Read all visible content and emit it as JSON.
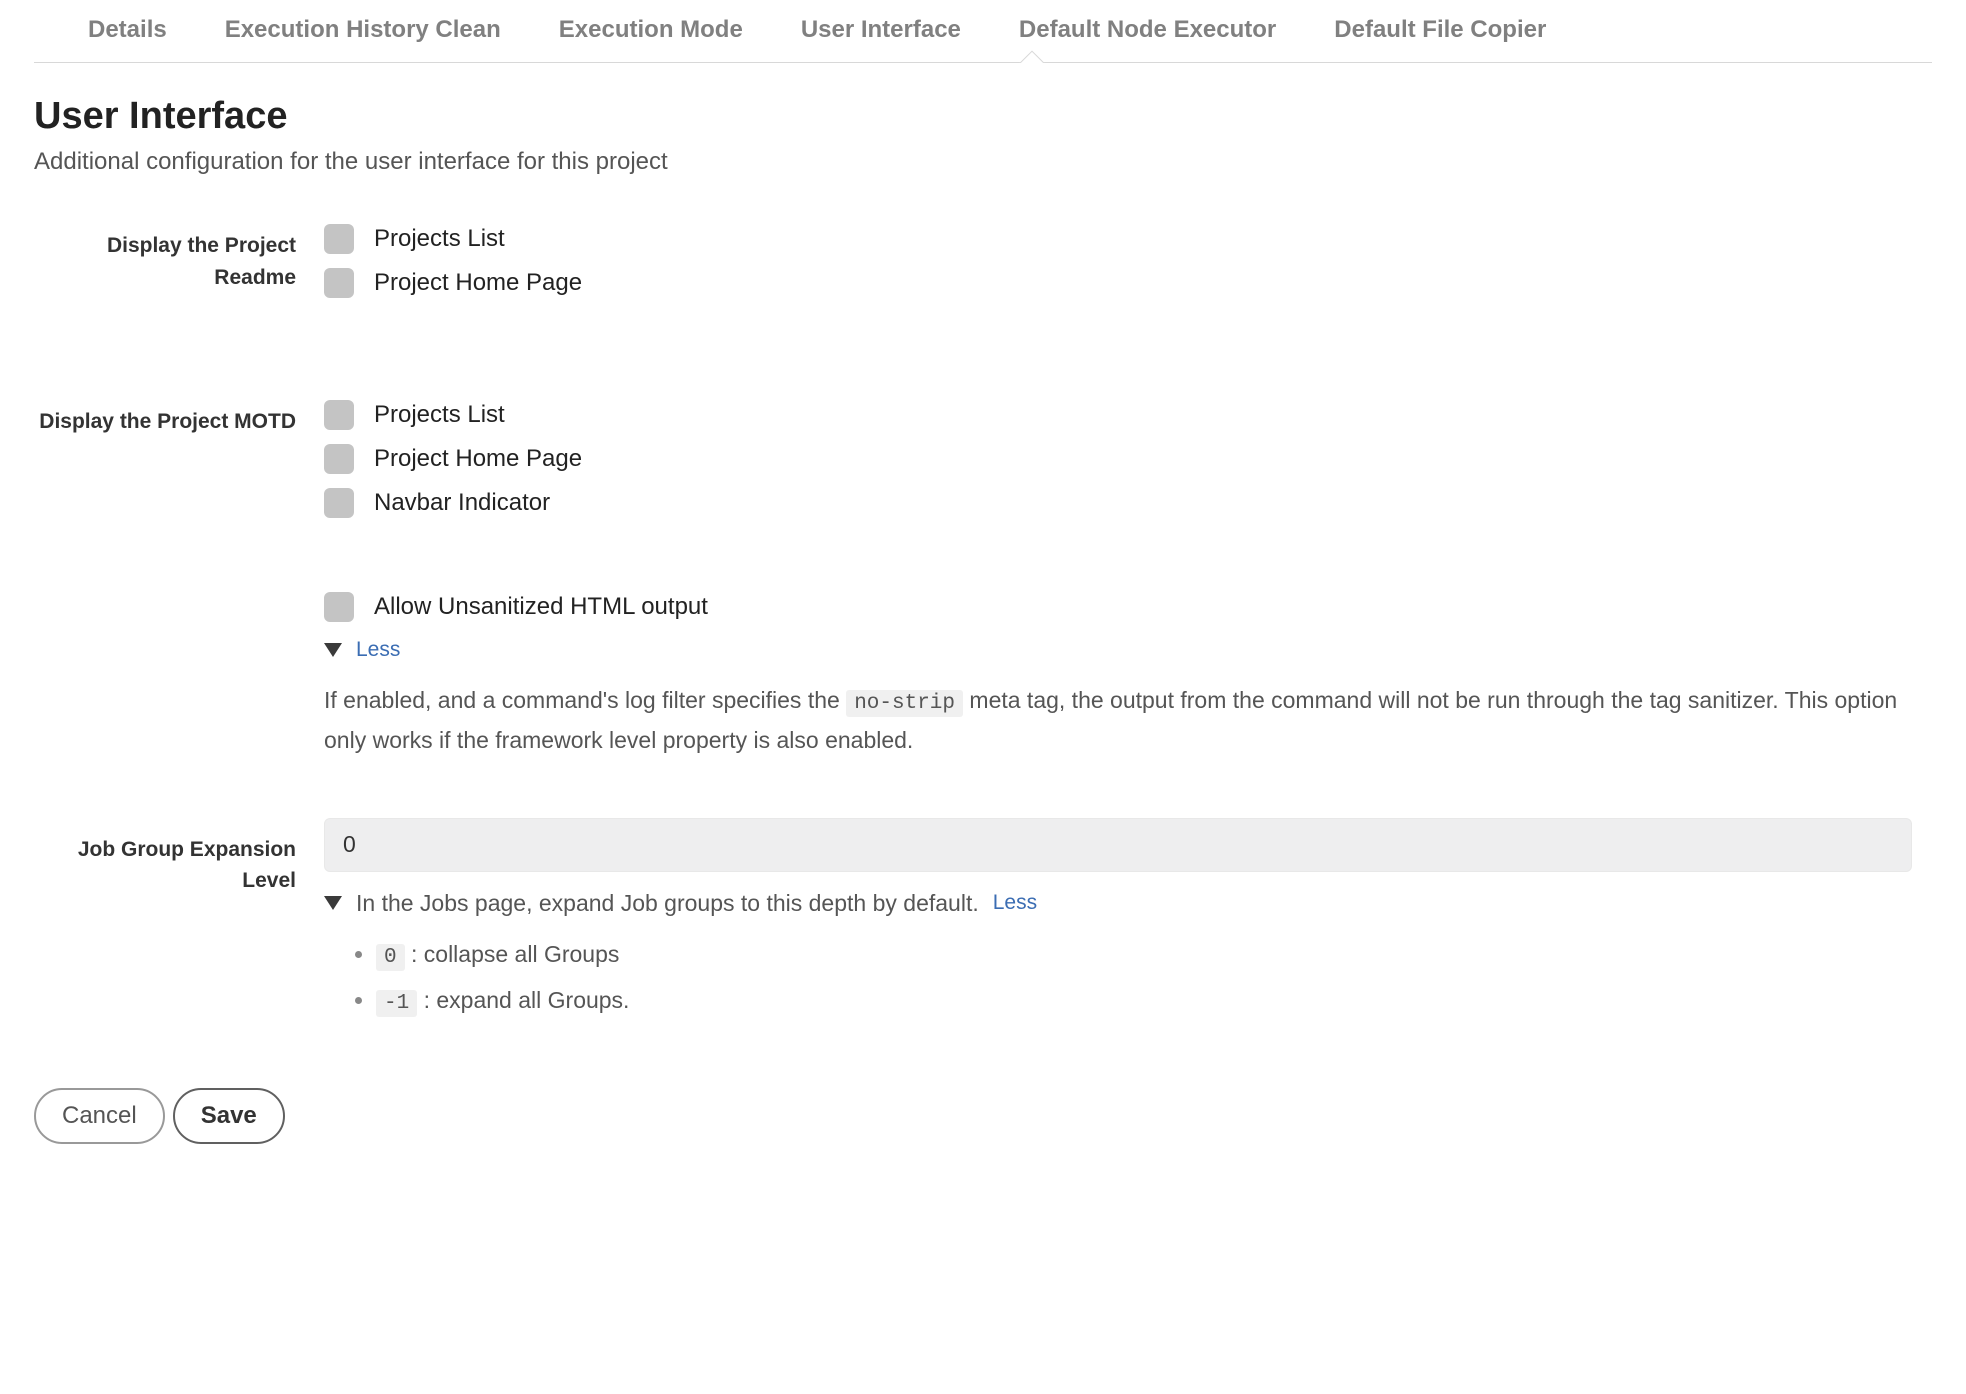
{
  "tabs": {
    "details": "Details",
    "execution_history_clean": "Execution History Clean",
    "execution_mode": "Execution Mode",
    "user_interface": "User Interface",
    "default_node_executor": "Default Node Executor",
    "default_file_copier": "Default File Copier"
  },
  "page": {
    "title": "User Interface",
    "subtitle": "Additional configuration for the user interface for this project"
  },
  "readme": {
    "label": "Display the Project Readme",
    "option1": "Projects List",
    "option2": "Project Home Page"
  },
  "motd": {
    "label": "Display the Project MOTD",
    "option1": "Projects List",
    "option2": "Project Home Page",
    "option3": "Navbar Indicator"
  },
  "html_output": {
    "checkbox_label": "Allow Unsanitized HTML output",
    "less_link": "Less",
    "help_pre": "If enabled, and a command's log filter specifies the ",
    "help_code": "no-strip",
    "help_post": " meta tag, the output from the command will not be run through the tag sanitizer. This option only works if the framework level property is also enabled."
  },
  "job_group": {
    "label": "Job Group Expansion Level",
    "value": "0",
    "hint": "In the Jobs page, expand Job groups to this depth by default.",
    "less_link": "Less",
    "li1_code": "0",
    "li1_text": " : collapse all Groups",
    "li2_code": "-1",
    "li2_text": " : expand all Groups."
  },
  "buttons": {
    "cancel": "Cancel",
    "save": "Save"
  }
}
